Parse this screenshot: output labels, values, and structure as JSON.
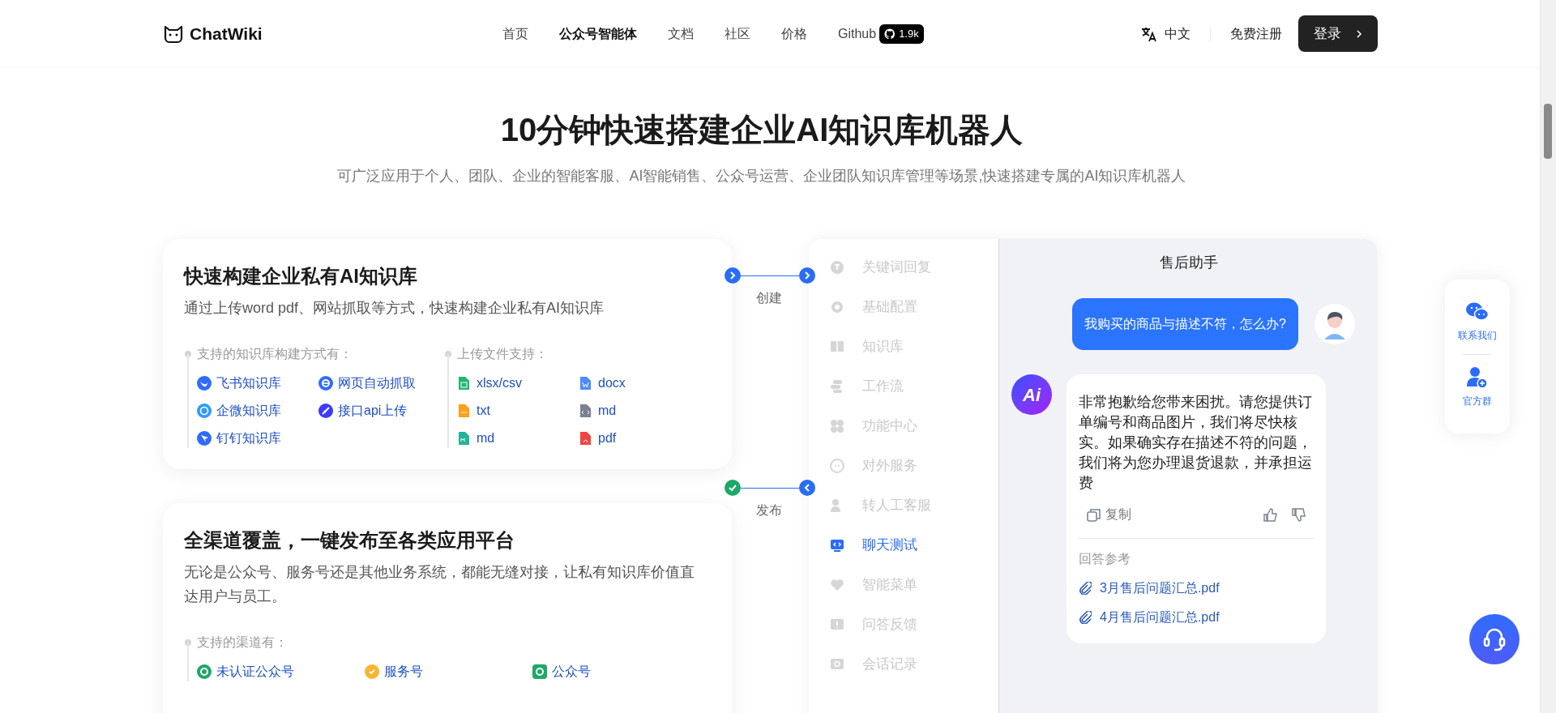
{
  "header": {
    "logo": "ChatWiki",
    "nav": [
      {
        "label": "首页",
        "selected": false
      },
      {
        "label": "公众号智能体",
        "selected": true
      },
      {
        "label": "文档",
        "selected": false
      },
      {
        "label": "社区",
        "selected": false
      },
      {
        "label": "价格",
        "selected": false
      },
      {
        "label": "Github",
        "selected": false,
        "badge": "1.9k"
      }
    ],
    "language": "中文",
    "register": "免费注册",
    "login": "登录"
  },
  "hero": {
    "title": "10分钟快速搭建企业AI知识库机器人",
    "subtitle": "可广泛应用于个人、团队、企业的智能客服、AI智能销售、公众号运营、企业团队知识库管理等场景,快速搭建专属的AI知识库机器人"
  },
  "features": [
    {
      "title": "快速构建企业私有AI知识库",
      "description": "通过上传word pdf、网站抓取等方式，快速构建企业私有AI知识库",
      "step": {
        "label": "创建",
        "done": false
      },
      "groups": [
        {
          "heading": "支持的知识库构建方式有：",
          "items": [
            "飞书知识库",
            "网页自动抓取",
            "企微知识库",
            "接口api上传",
            "钉钉知识库"
          ]
        },
        {
          "heading": "上传文件支持：",
          "items": [
            "xlsx/csv",
            "docx",
            "txt",
            "md",
            "md",
            "pdf"
          ]
        }
      ]
    },
    {
      "title": "全渠道覆盖，一键发布至各类应用平台",
      "description": "无论是公众号、服务号还是其他业务系统，都能无缝对接，让私有知识库价值直达用户与员工。",
      "step": {
        "label": "发布",
        "done": true
      },
      "groups": [
        {
          "heading": "支持的渠道有：",
          "items": [
            "未认证公众号",
            "服务号",
            "公众号"
          ]
        }
      ]
    }
  ],
  "menu": [
    {
      "label": "关键词回复",
      "selected": false
    },
    {
      "label": "基础配置",
      "selected": false
    },
    {
      "label": "知识库",
      "selected": false
    },
    {
      "label": "工作流",
      "selected": false
    },
    {
      "label": "功能中心",
      "selected": false
    },
    {
      "label": "对外服务",
      "selected": false
    },
    {
      "label": "转人工客服",
      "selected": false
    },
    {
      "label": "聊天测试",
      "selected": true
    },
    {
      "label": "智能菜单",
      "selected": false
    },
    {
      "label": "问答反馈",
      "selected": false
    },
    {
      "label": "会话记录",
      "selected": false
    }
  ],
  "chat": {
    "title": "售后助手",
    "messages": [
      {
        "kind": "user",
        "text": "我购买的商品与描述不符，怎么办?"
      },
      {
        "kind": "assistant",
        "avatar_text": "Ai",
        "text": "非常抱歉给您带来困扰。请您提供订单编号和商品图片，我们将尽快核实。如果确实存在描述不符的问题，我们将为您办理退货退款，并承担运费",
        "copy": "复制",
        "references_heading": "回答参考",
        "references": [
          "3月售后问题汇总.pdf",
          "4月售后问题汇总.pdf"
        ]
      }
    ]
  },
  "float_panel": [
    "联系我们",
    "官方群"
  ]
}
